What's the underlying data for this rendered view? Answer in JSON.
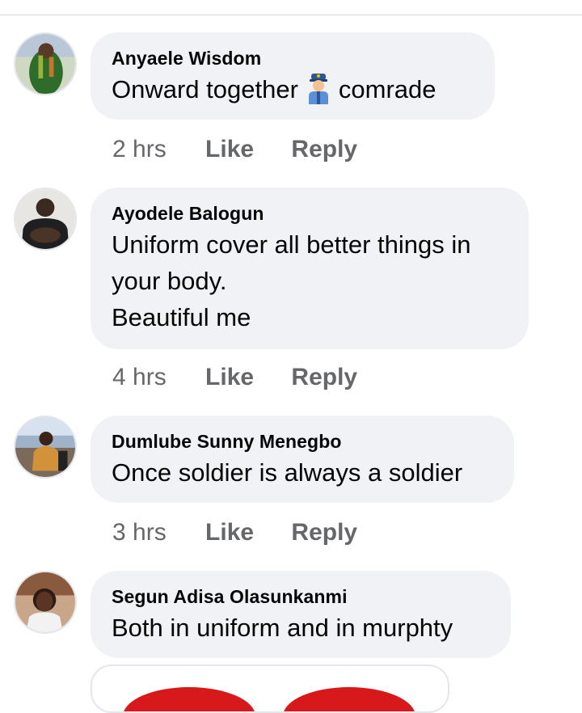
{
  "comments": [
    {
      "author": "Anyaele Wisdom",
      "text_before_emoji": "Onward together",
      "emoji": "police-officer-emoji",
      "text_after_emoji": "comrade",
      "time": "2 hrs",
      "like_label": "Like",
      "reply_label": "Reply"
    },
    {
      "author": "Ayodele Balogun",
      "text": "Uniform cover all better things in\nyour body.\nBeautiful me",
      "time": "4 hrs",
      "like_label": "Like",
      "reply_label": "Reply"
    },
    {
      "author": "Dumlube Sunny Menegbo",
      "text": "Once soldier is always a soldier",
      "time": "3 hrs",
      "like_label": "Like",
      "reply_label": "Reply"
    },
    {
      "author": "Segun Adisa Olasunkanmi",
      "text": "Both in uniform and in murphty",
      "time": "",
      "like_label": "",
      "reply_label": ""
    }
  ],
  "colors": {
    "bubble_bg": "#f0f2f5",
    "meta_text": "#65676b",
    "heart_red": "#d7191c"
  },
  "icons": [
    "police-officer-emoji",
    "heart-sticker"
  ]
}
